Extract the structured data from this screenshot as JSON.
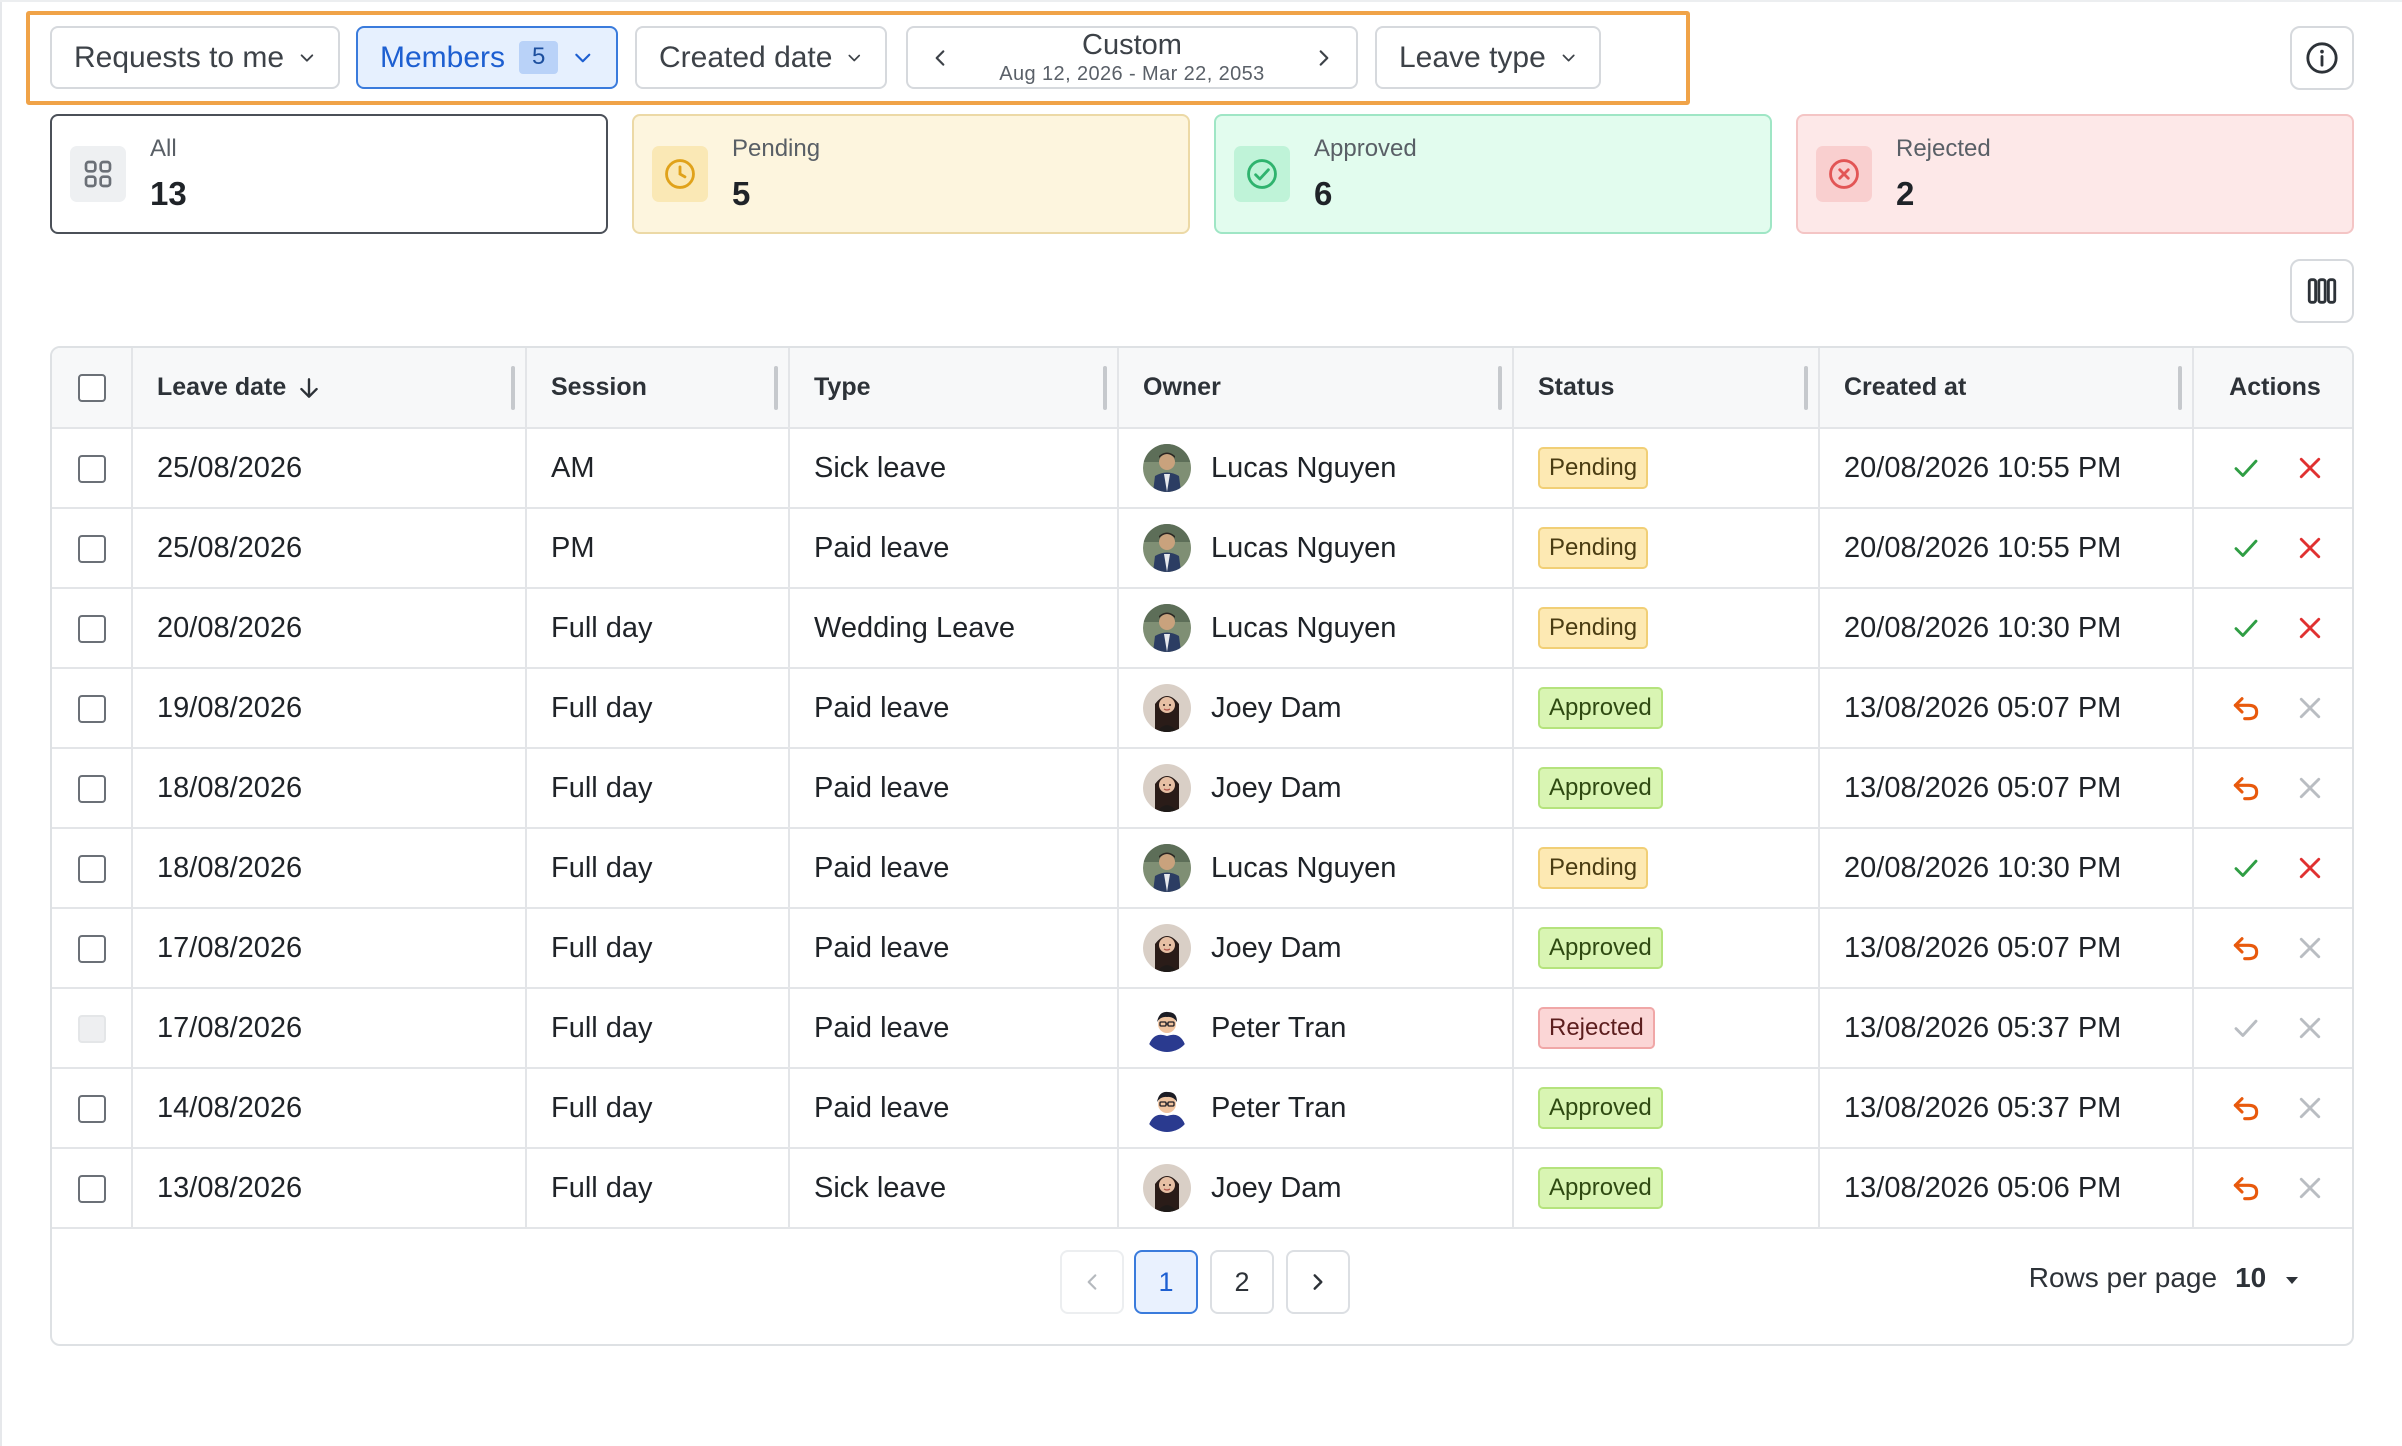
{
  "filters": {
    "requests_label": "Requests to me",
    "members_label": "Members",
    "members_count": "5",
    "created_date_label": "Created date",
    "date_nav_label": "Custom",
    "date_nav_range": "Aug 12, 2026 - Mar 22, 2053",
    "leave_type_label": "Leave type"
  },
  "stats": {
    "all": {
      "label": "All",
      "value": "13"
    },
    "pending": {
      "label": "Pending",
      "value": "5"
    },
    "approved": {
      "label": "Approved",
      "value": "6"
    },
    "rejected": {
      "label": "Rejected",
      "value": "2"
    }
  },
  "table": {
    "columns": [
      "Leave date",
      "Session",
      "Type",
      "Owner",
      "Status",
      "Created at",
      "Actions"
    ],
    "rows": [
      {
        "date": "25/08/2026",
        "session": "AM",
        "type": "Sick leave",
        "owner": "Lucas Nguyen",
        "avatar": "lucas",
        "status": "Pending",
        "created": "20/08/2026 10:55 PM",
        "selectable": true
      },
      {
        "date": "25/08/2026",
        "session": "PM",
        "type": "Paid leave",
        "owner": "Lucas Nguyen",
        "avatar": "lucas",
        "status": "Pending",
        "created": "20/08/2026 10:55 PM",
        "selectable": true
      },
      {
        "date": "20/08/2026",
        "session": "Full day",
        "type": "Wedding Leave",
        "owner": "Lucas Nguyen",
        "avatar": "lucas",
        "status": "Pending",
        "created": "20/08/2026 10:30 PM",
        "selectable": true
      },
      {
        "date": "19/08/2026",
        "session": "Full day",
        "type": "Paid leave",
        "owner": "Joey Dam",
        "avatar": "joey",
        "status": "Approved",
        "created": "13/08/2026 05:07 PM",
        "selectable": true
      },
      {
        "date": "18/08/2026",
        "session": "Full day",
        "type": "Paid leave",
        "owner": "Joey Dam",
        "avatar": "joey",
        "status": "Approved",
        "created": "13/08/2026 05:07 PM",
        "selectable": true
      },
      {
        "date": "18/08/2026",
        "session": "Full day",
        "type": "Paid leave",
        "owner": "Lucas Nguyen",
        "avatar": "lucas",
        "status": "Pending",
        "created": "20/08/2026 10:30 PM",
        "selectable": true
      },
      {
        "date": "17/08/2026",
        "session": "Full day",
        "type": "Paid leave",
        "owner": "Joey Dam",
        "avatar": "joey",
        "status": "Approved",
        "created": "13/08/2026 05:07 PM",
        "selectable": true
      },
      {
        "date": "17/08/2026",
        "session": "Full day",
        "type": "Paid leave",
        "owner": "Peter Tran",
        "avatar": "peter",
        "status": "Rejected",
        "created": "13/08/2026 05:37 PM",
        "selectable": false
      },
      {
        "date": "14/08/2026",
        "session": "Full day",
        "type": "Paid leave",
        "owner": "Peter Tran",
        "avatar": "peter",
        "status": "Approved",
        "created": "13/08/2026 05:37 PM",
        "selectable": true
      },
      {
        "date": "13/08/2026",
        "session": "Full day",
        "type": "Sick leave",
        "owner": "Joey Dam",
        "avatar": "joey",
        "status": "Approved",
        "created": "13/08/2026 05:06 PM",
        "selectable": true
      }
    ]
  },
  "pagination": {
    "pages": [
      "1",
      "2"
    ],
    "current_page": "1",
    "rows_per_page_label": "Rows per page",
    "rows_per_page_value": "10"
  },
  "colors": {
    "accent": "#3a7bdc",
    "highlight": "#f0a348",
    "approve": "#2f9e44",
    "reject": "#e03131",
    "revert": "#e8590c"
  }
}
